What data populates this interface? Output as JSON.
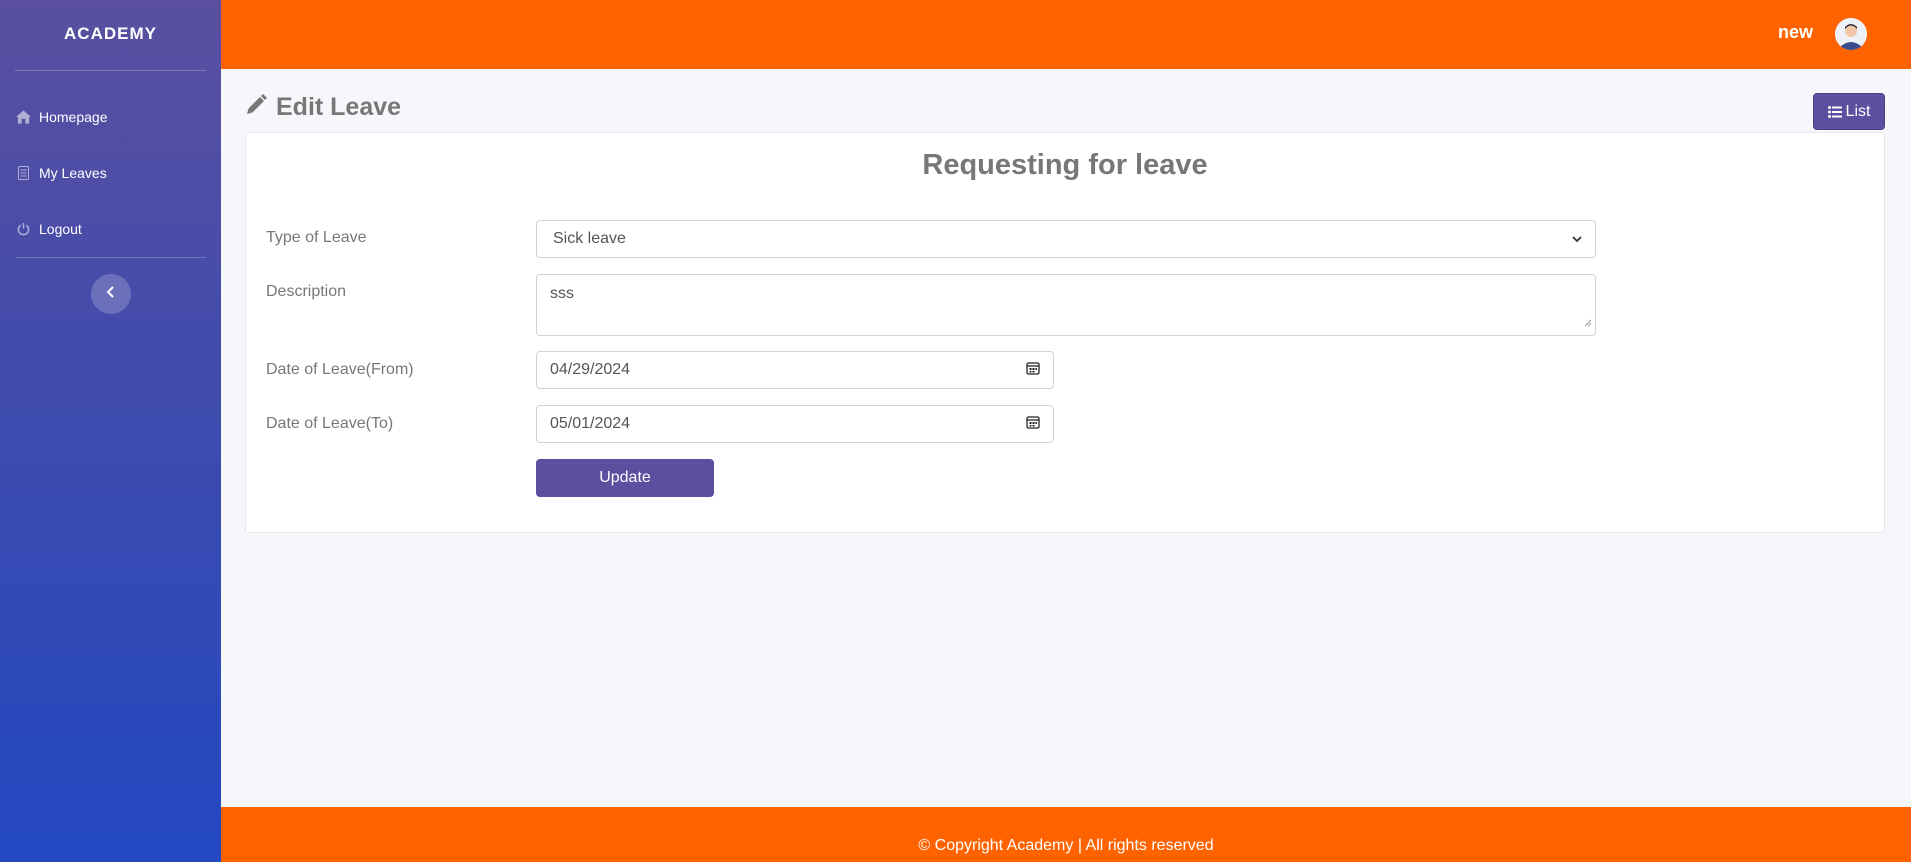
{
  "brand": "ACADEMY",
  "sidebar": {
    "items": [
      {
        "label": "Homepage",
        "icon": "home-icon"
      },
      {
        "label": "My Leaves",
        "icon": "document-icon"
      },
      {
        "label": "Logout",
        "icon": "power-icon"
      }
    ],
    "collapse_icon": "chevron-left-icon"
  },
  "topbar": {
    "user_name": "new",
    "avatar_icon": "avatar-icon"
  },
  "page": {
    "title": "Edit Leave",
    "title_icon": "pencil-icon",
    "list_button": "List",
    "list_icon": "list-icon"
  },
  "form": {
    "heading": "Requesting for leave",
    "type_label": "Type of Leave",
    "type_value": "Sick leave",
    "description_label": "Description",
    "description_value": "sss",
    "from_label": "Date of Leave(From)",
    "from_value": "04/29/2024",
    "to_label": "Date of Leave(To)",
    "to_value": "05/01/2024",
    "submit_label": "Update"
  },
  "footer": {
    "text": "© Copyright Academy | All rights reserved"
  },
  "colors": {
    "accent": "#ff6300",
    "primary": "#5c4f9f",
    "sidebar_top": "#5a4fa0",
    "sidebar_bottom": "#2348c2"
  }
}
